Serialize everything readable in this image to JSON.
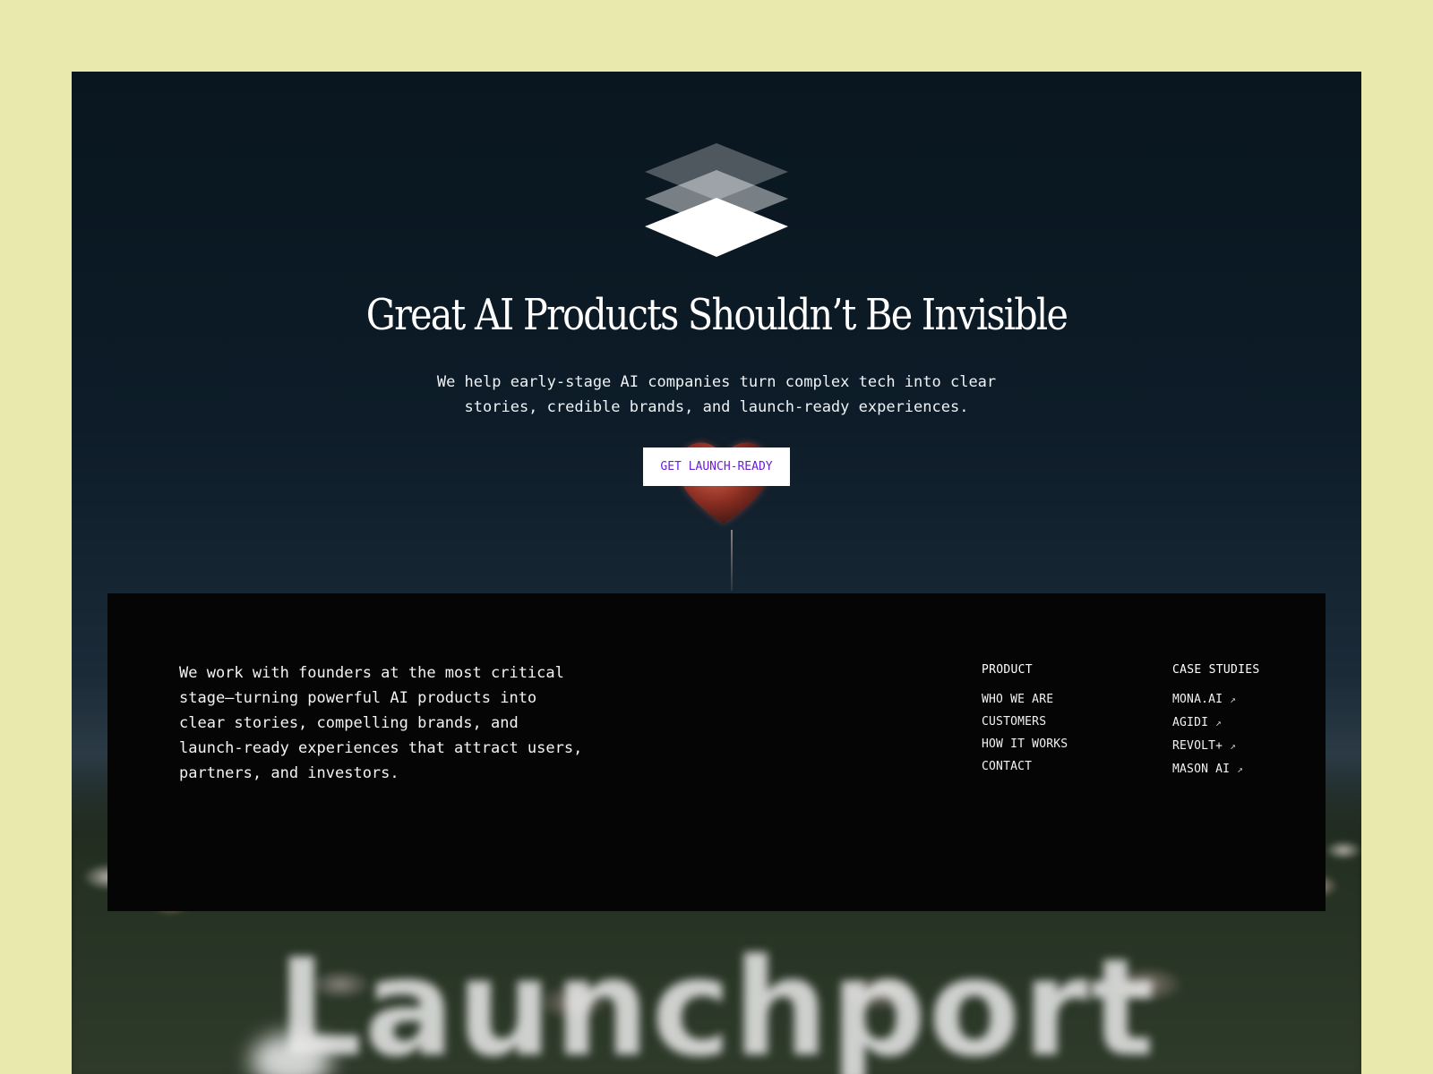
{
  "hero": {
    "headline": "Great AI Products Shouldn’t Be Invisible",
    "subhead_line1": "We help early-stage AI companies turn complex tech into clear",
    "subhead_line2": "stories, credible brands, and launch-ready experiences.",
    "cta_label": "GET LAUNCH-READY",
    "logo_icon": "layers-stack-icon",
    "background_image": "heart-balloon-over-flower-field",
    "colors": {
      "page_background": "#e9e8ad",
      "cta_text": "#6a1fd8",
      "footer_background": "#050505"
    }
  },
  "footer": {
    "blurb": "We work with founders at the most critical stage—turning powerful AI products into clear stories, compelling brands, and launch-ready experiences that attract users, partners, and investors.",
    "product": {
      "heading": "PRODUCT",
      "links": [
        "WHO WE ARE",
        "CUSTOMERS",
        "HOW IT WORKS",
        "CONTACT"
      ]
    },
    "case_studies": {
      "heading": "CASE STUDIES",
      "links": [
        "MONA.AI",
        "AGIDI",
        "REVOLT+",
        "MASON AI"
      ],
      "link_icon": "external-arrow-icon",
      "link_glyph": "↗"
    }
  },
  "wordmark": "Launchport"
}
